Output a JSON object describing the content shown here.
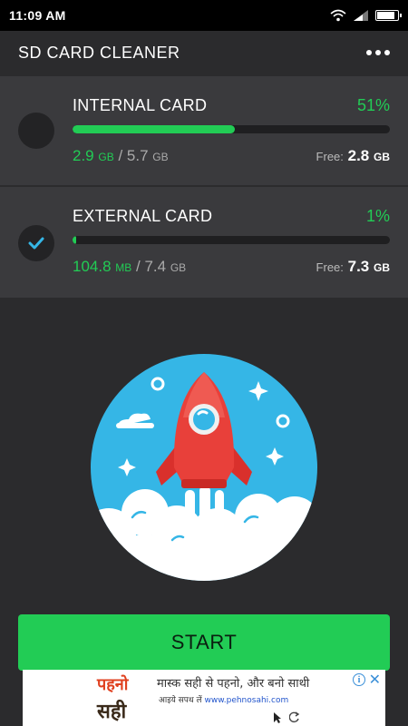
{
  "status_bar": {
    "time": "11:09 AM"
  },
  "app": {
    "title": "SD CARD CLEANER"
  },
  "internal_card": {
    "name": "INTERNAL CARD",
    "percent_label": "51%",
    "percent": 51,
    "used_value": "2.9",
    "used_unit": "GB",
    "separator": " / ",
    "total_value": "5.7",
    "total_unit": "GB",
    "free_label": "Free:",
    "free_value": "2.8",
    "free_unit": "GB",
    "selected": false
  },
  "external_card": {
    "name": "EXTERNAL CARD",
    "percent_label": "1%",
    "percent": 1,
    "used_value": "104.8",
    "used_unit": "MB",
    "separator": " / ",
    "total_value": "7.4",
    "total_unit": "GB",
    "free_label": "Free:",
    "free_value": "7.3",
    "free_unit": "GB",
    "selected": true
  },
  "start_button": {
    "label": "START"
  },
  "ad": {
    "logo_line1": "पहनो",
    "logo_line2": "सही",
    "headline": "मास्क सही से पहनो, और बनो साथी",
    "sub_prefix": "आइये सपथ लें",
    "sub_url": "www.pehnosahi.com"
  },
  "colors": {
    "accent": "#22cc55",
    "background": "#2b2b2d",
    "card": "#3a3a3d",
    "circle_bg": "#35b6e6"
  }
}
